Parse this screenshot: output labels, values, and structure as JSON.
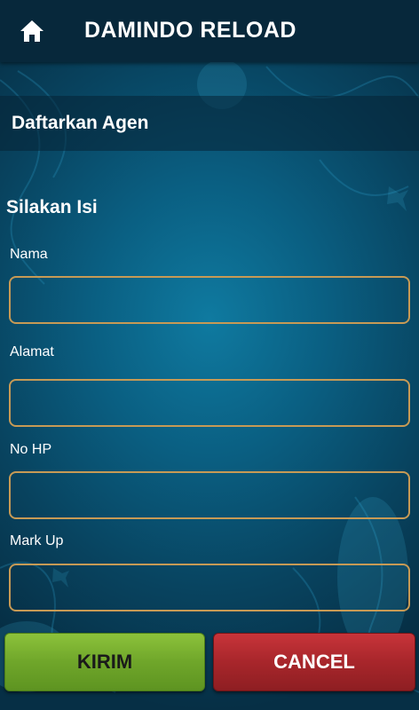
{
  "appbar": {
    "icon": "home-icon",
    "title": "DAMINDO RELOAD",
    "color": "#07283b"
  },
  "section": {
    "title": "Daftarkan Agen"
  },
  "form": {
    "title": "Silakan Isi",
    "fields": [
      {
        "label": "Nama",
        "value": ""
      },
      {
        "label": "Alamat",
        "value": ""
      },
      {
        "label": "No HP",
        "value": ""
      },
      {
        "label": "Mark Up",
        "value": ""
      }
    ],
    "field_border_color": "#c79a55"
  },
  "buttons": {
    "submit_label": "KIRIM",
    "submit_color": "#6fa62a",
    "cancel_label": "CANCEL",
    "cancel_color": "#a8262b"
  }
}
